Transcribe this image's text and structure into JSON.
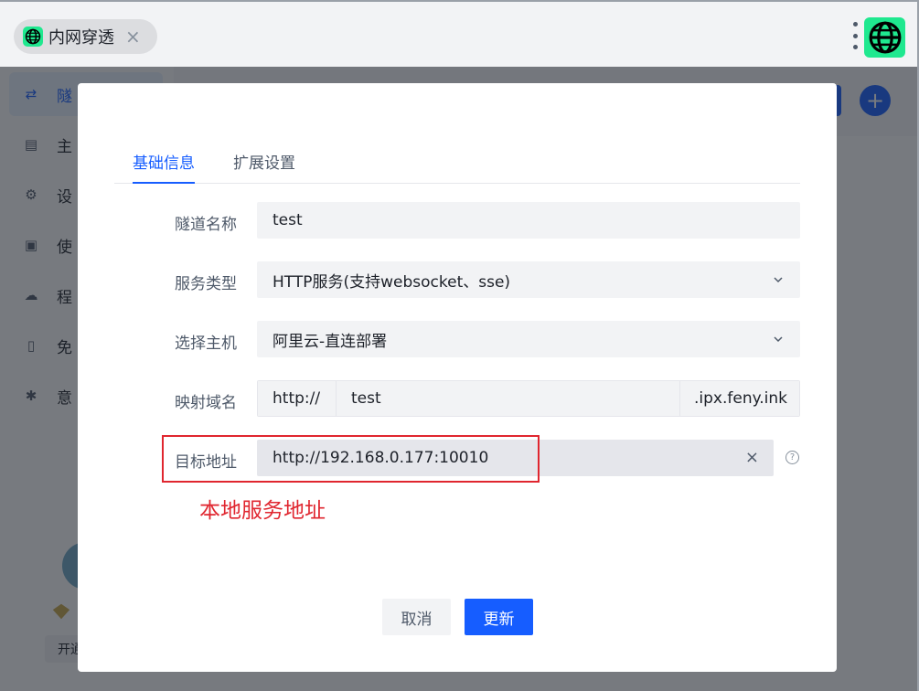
{
  "browser_tab": {
    "title": "内网穿透",
    "close_icon": "×",
    "icon": "globe-icon"
  },
  "app_logo": {
    "icon": "globe-icon",
    "color": "#1fe88f"
  },
  "sidebar": {
    "items": [
      {
        "icon": "swap-icon",
        "label": "隧",
        "active": true
      },
      {
        "icon": "list-icon",
        "label": "主"
      },
      {
        "icon": "gear-icon",
        "label": "设"
      },
      {
        "icon": "document-icon",
        "label": "使"
      },
      {
        "icon": "cloud-refresh-icon",
        "label": "程"
      },
      {
        "icon": "file-icon",
        "label": "免"
      },
      {
        "icon": "bug-icon",
        "label": "意"
      }
    ],
    "renew_label": "开通"
  },
  "modal": {
    "tabs": [
      {
        "label": "基础信息",
        "active": true
      },
      {
        "label": "扩展设置",
        "active": false
      }
    ],
    "fields": {
      "tunnel_name": {
        "label": "隧道名称",
        "value": "test"
      },
      "service_type": {
        "label": "服务类型",
        "value": "HTTP服务(支持websocket、sse)"
      },
      "host": {
        "label": "选择主机",
        "value": "阿里云-直连部署"
      },
      "domain": {
        "label": "映射域名",
        "prefix": "http://",
        "value": "test",
        "suffix": ".ipx.feny.ink"
      },
      "target": {
        "label": "目标地址",
        "value": "http://192.168.0.177:10010",
        "clear": "×",
        "help": "?"
      }
    },
    "annotation": "本地服务地址",
    "buttons": {
      "cancel": "取消",
      "update": "更新"
    }
  },
  "colors": {
    "primary": "#165dff",
    "annotation_red": "#e0262f",
    "brand_green": "#1fe88f"
  }
}
